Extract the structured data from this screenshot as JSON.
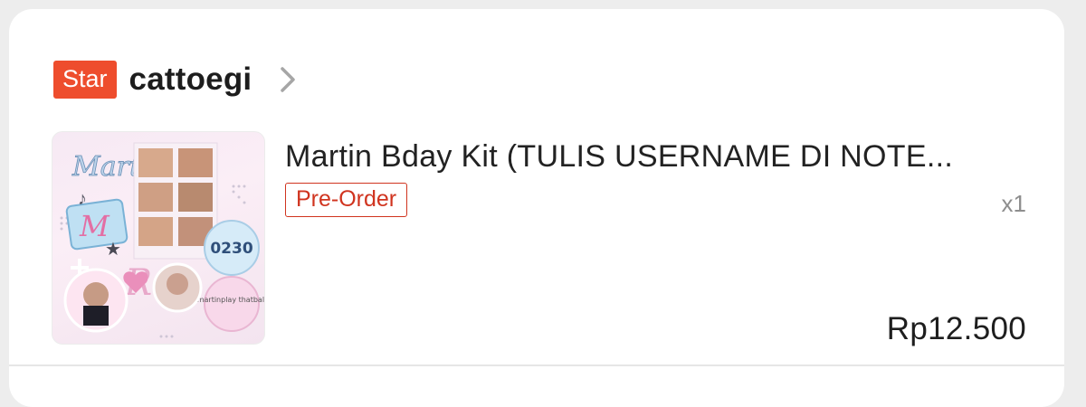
{
  "shop": {
    "badge": "Star",
    "name": "cattoegi"
  },
  "product": {
    "title": "Martin Bday Kit (TULIS USERNAME DI NOTE...",
    "tag": "Pre-Order",
    "quantity": "x1",
    "price": "Rp12.500",
    "thumbnail_texts": {
      "badge_number": "0230",
      "badge_caption": "martinplay thatball"
    }
  },
  "colors": {
    "accent": "#ee4d2d",
    "tag_red": "#d0341f",
    "background": "#ededed",
    "card": "#ffffff"
  },
  "icons": {
    "shop_chevron": "chevron-right-icon"
  }
}
